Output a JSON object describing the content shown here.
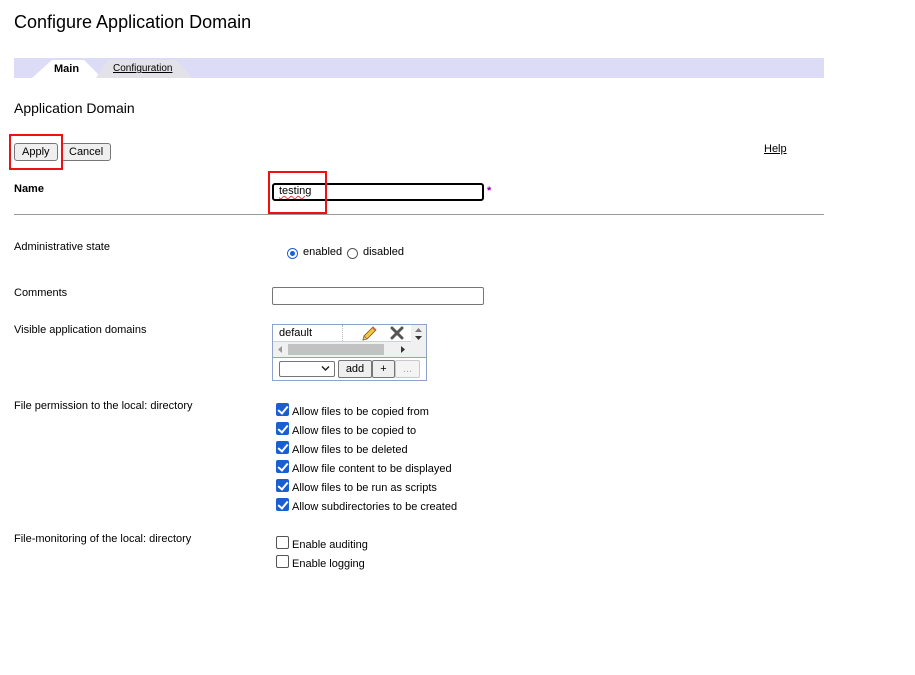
{
  "page": {
    "title": "Configure Application Domain"
  },
  "tabs": [
    {
      "label": "Main",
      "active": true
    },
    {
      "label": "Configuration",
      "active": false
    }
  ],
  "section": {
    "title": "Application Domain"
  },
  "actions": {
    "apply_label": "Apply",
    "cancel_label": "Cancel",
    "help_label": "Help"
  },
  "name": {
    "label": "Name",
    "value": "testing",
    "required_marker": "*"
  },
  "admin_state": {
    "label": "Administrative state",
    "options": [
      {
        "label": "enabled",
        "checked": true
      },
      {
        "label": "disabled",
        "checked": false
      }
    ]
  },
  "comments": {
    "label": "Comments",
    "value": ""
  },
  "visible_domains": {
    "label": "Visible application domains",
    "items": [
      "default"
    ],
    "selected_option": "",
    "add_label": "add",
    "plus_label": "+",
    "more_label": "..."
  },
  "file_permission": {
    "label": "File permission to the local: directory",
    "options": [
      {
        "label": "Allow files to be copied from",
        "checked": true
      },
      {
        "label": "Allow files to be copied to",
        "checked": true
      },
      {
        "label": "Allow files to be deleted",
        "checked": true
      },
      {
        "label": "Allow file content to be displayed",
        "checked": true
      },
      {
        "label": "Allow files to be run as scripts",
        "checked": true
      },
      {
        "label": "Allow subdirectories to be created",
        "checked": true
      }
    ]
  },
  "file_monitoring": {
    "label": "File-monitoring of the local: directory",
    "options": [
      {
        "label": "Enable auditing",
        "checked": false
      },
      {
        "label": "Enable logging",
        "checked": false
      }
    ]
  },
  "colors": {
    "tab_bar": "#dcdcf6",
    "highlight": "#ee1111",
    "required": "#8b00aa",
    "check_accent": "#1a5fd0"
  },
  "icons": {
    "edit": "pencil-icon",
    "delete": "delete-x-icon"
  }
}
